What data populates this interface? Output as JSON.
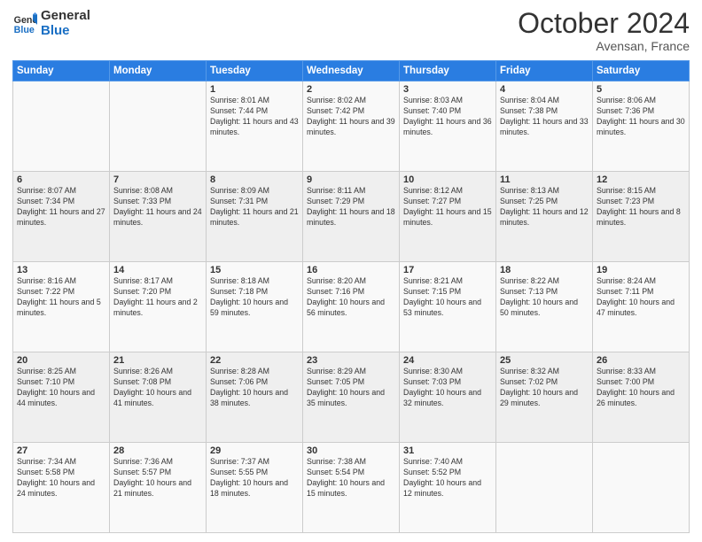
{
  "header": {
    "logo_line1": "General",
    "logo_line2": "Blue",
    "month": "October 2024",
    "location": "Avensan, France"
  },
  "weekdays": [
    "Sunday",
    "Monday",
    "Tuesday",
    "Wednesday",
    "Thursday",
    "Friday",
    "Saturday"
  ],
  "weeks": [
    [
      {
        "day": "",
        "sunrise": "",
        "sunset": "",
        "daylight": ""
      },
      {
        "day": "",
        "sunrise": "",
        "sunset": "",
        "daylight": ""
      },
      {
        "day": "1",
        "sunrise": "Sunrise: 8:01 AM",
        "sunset": "Sunset: 7:44 PM",
        "daylight": "Daylight: 11 hours and 43 minutes."
      },
      {
        "day": "2",
        "sunrise": "Sunrise: 8:02 AM",
        "sunset": "Sunset: 7:42 PM",
        "daylight": "Daylight: 11 hours and 39 minutes."
      },
      {
        "day": "3",
        "sunrise": "Sunrise: 8:03 AM",
        "sunset": "Sunset: 7:40 PM",
        "daylight": "Daylight: 11 hours and 36 minutes."
      },
      {
        "day": "4",
        "sunrise": "Sunrise: 8:04 AM",
        "sunset": "Sunset: 7:38 PM",
        "daylight": "Daylight: 11 hours and 33 minutes."
      },
      {
        "day": "5",
        "sunrise": "Sunrise: 8:06 AM",
        "sunset": "Sunset: 7:36 PM",
        "daylight": "Daylight: 11 hours and 30 minutes."
      }
    ],
    [
      {
        "day": "6",
        "sunrise": "Sunrise: 8:07 AM",
        "sunset": "Sunset: 7:34 PM",
        "daylight": "Daylight: 11 hours and 27 minutes."
      },
      {
        "day": "7",
        "sunrise": "Sunrise: 8:08 AM",
        "sunset": "Sunset: 7:33 PM",
        "daylight": "Daylight: 11 hours and 24 minutes."
      },
      {
        "day": "8",
        "sunrise": "Sunrise: 8:09 AM",
        "sunset": "Sunset: 7:31 PM",
        "daylight": "Daylight: 11 hours and 21 minutes."
      },
      {
        "day": "9",
        "sunrise": "Sunrise: 8:11 AM",
        "sunset": "Sunset: 7:29 PM",
        "daylight": "Daylight: 11 hours and 18 minutes."
      },
      {
        "day": "10",
        "sunrise": "Sunrise: 8:12 AM",
        "sunset": "Sunset: 7:27 PM",
        "daylight": "Daylight: 11 hours and 15 minutes."
      },
      {
        "day": "11",
        "sunrise": "Sunrise: 8:13 AM",
        "sunset": "Sunset: 7:25 PM",
        "daylight": "Daylight: 11 hours and 12 minutes."
      },
      {
        "day": "12",
        "sunrise": "Sunrise: 8:15 AM",
        "sunset": "Sunset: 7:23 PM",
        "daylight": "Daylight: 11 hours and 8 minutes."
      }
    ],
    [
      {
        "day": "13",
        "sunrise": "Sunrise: 8:16 AM",
        "sunset": "Sunset: 7:22 PM",
        "daylight": "Daylight: 11 hours and 5 minutes."
      },
      {
        "day": "14",
        "sunrise": "Sunrise: 8:17 AM",
        "sunset": "Sunset: 7:20 PM",
        "daylight": "Daylight: 11 hours and 2 minutes."
      },
      {
        "day": "15",
        "sunrise": "Sunrise: 8:18 AM",
        "sunset": "Sunset: 7:18 PM",
        "daylight": "Daylight: 10 hours and 59 minutes."
      },
      {
        "day": "16",
        "sunrise": "Sunrise: 8:20 AM",
        "sunset": "Sunset: 7:16 PM",
        "daylight": "Daylight: 10 hours and 56 minutes."
      },
      {
        "day": "17",
        "sunrise": "Sunrise: 8:21 AM",
        "sunset": "Sunset: 7:15 PM",
        "daylight": "Daylight: 10 hours and 53 minutes."
      },
      {
        "day": "18",
        "sunrise": "Sunrise: 8:22 AM",
        "sunset": "Sunset: 7:13 PM",
        "daylight": "Daylight: 10 hours and 50 minutes."
      },
      {
        "day": "19",
        "sunrise": "Sunrise: 8:24 AM",
        "sunset": "Sunset: 7:11 PM",
        "daylight": "Daylight: 10 hours and 47 minutes."
      }
    ],
    [
      {
        "day": "20",
        "sunrise": "Sunrise: 8:25 AM",
        "sunset": "Sunset: 7:10 PM",
        "daylight": "Daylight: 10 hours and 44 minutes."
      },
      {
        "day": "21",
        "sunrise": "Sunrise: 8:26 AM",
        "sunset": "Sunset: 7:08 PM",
        "daylight": "Daylight: 10 hours and 41 minutes."
      },
      {
        "day": "22",
        "sunrise": "Sunrise: 8:28 AM",
        "sunset": "Sunset: 7:06 PM",
        "daylight": "Daylight: 10 hours and 38 minutes."
      },
      {
        "day": "23",
        "sunrise": "Sunrise: 8:29 AM",
        "sunset": "Sunset: 7:05 PM",
        "daylight": "Daylight: 10 hours and 35 minutes."
      },
      {
        "day": "24",
        "sunrise": "Sunrise: 8:30 AM",
        "sunset": "Sunset: 7:03 PM",
        "daylight": "Daylight: 10 hours and 32 minutes."
      },
      {
        "day": "25",
        "sunrise": "Sunrise: 8:32 AM",
        "sunset": "Sunset: 7:02 PM",
        "daylight": "Daylight: 10 hours and 29 minutes."
      },
      {
        "day": "26",
        "sunrise": "Sunrise: 8:33 AM",
        "sunset": "Sunset: 7:00 PM",
        "daylight": "Daylight: 10 hours and 26 minutes."
      }
    ],
    [
      {
        "day": "27",
        "sunrise": "Sunrise: 7:34 AM",
        "sunset": "Sunset: 5:58 PM",
        "daylight": "Daylight: 10 hours and 24 minutes."
      },
      {
        "day": "28",
        "sunrise": "Sunrise: 7:36 AM",
        "sunset": "Sunset: 5:57 PM",
        "daylight": "Daylight: 10 hours and 21 minutes."
      },
      {
        "day": "29",
        "sunrise": "Sunrise: 7:37 AM",
        "sunset": "Sunset: 5:55 PM",
        "daylight": "Daylight: 10 hours and 18 minutes."
      },
      {
        "day": "30",
        "sunrise": "Sunrise: 7:38 AM",
        "sunset": "Sunset: 5:54 PM",
        "daylight": "Daylight: 10 hours and 15 minutes."
      },
      {
        "day": "31",
        "sunrise": "Sunrise: 7:40 AM",
        "sunset": "Sunset: 5:52 PM",
        "daylight": "Daylight: 10 hours and 12 minutes."
      },
      {
        "day": "",
        "sunrise": "",
        "sunset": "",
        "daylight": ""
      },
      {
        "day": "",
        "sunrise": "",
        "sunset": "",
        "daylight": ""
      }
    ]
  ]
}
